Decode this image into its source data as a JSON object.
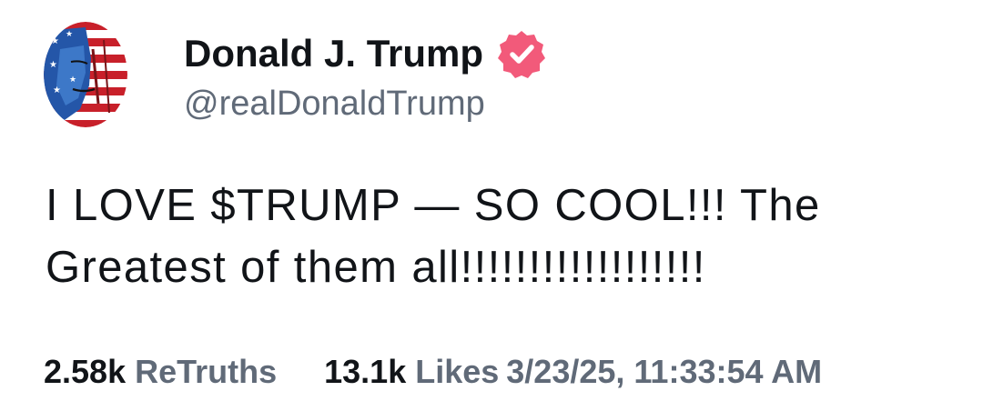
{
  "author": {
    "display_name": "Donald J. Trump",
    "handle": "@realDonaldTrump",
    "avatar": "flag-portrait-avatar",
    "verified_icon": "verified-badge-icon",
    "verified_color": "#f25a7a"
  },
  "post": {
    "text": "I LOVE $TRUMP — SO COOL!!! The Greatest of them all!!!!!!!!!!!!!!!!!!"
  },
  "stats": {
    "retruths_count": "2.58k",
    "retruths_label": "ReTruths",
    "likes_count": "13.1k",
    "likes_label": "Likes",
    "timestamp": "3/23/25, 11:33:54 AM"
  },
  "colors": {
    "text_primary": "#111418",
    "text_secondary": "#606a78"
  }
}
